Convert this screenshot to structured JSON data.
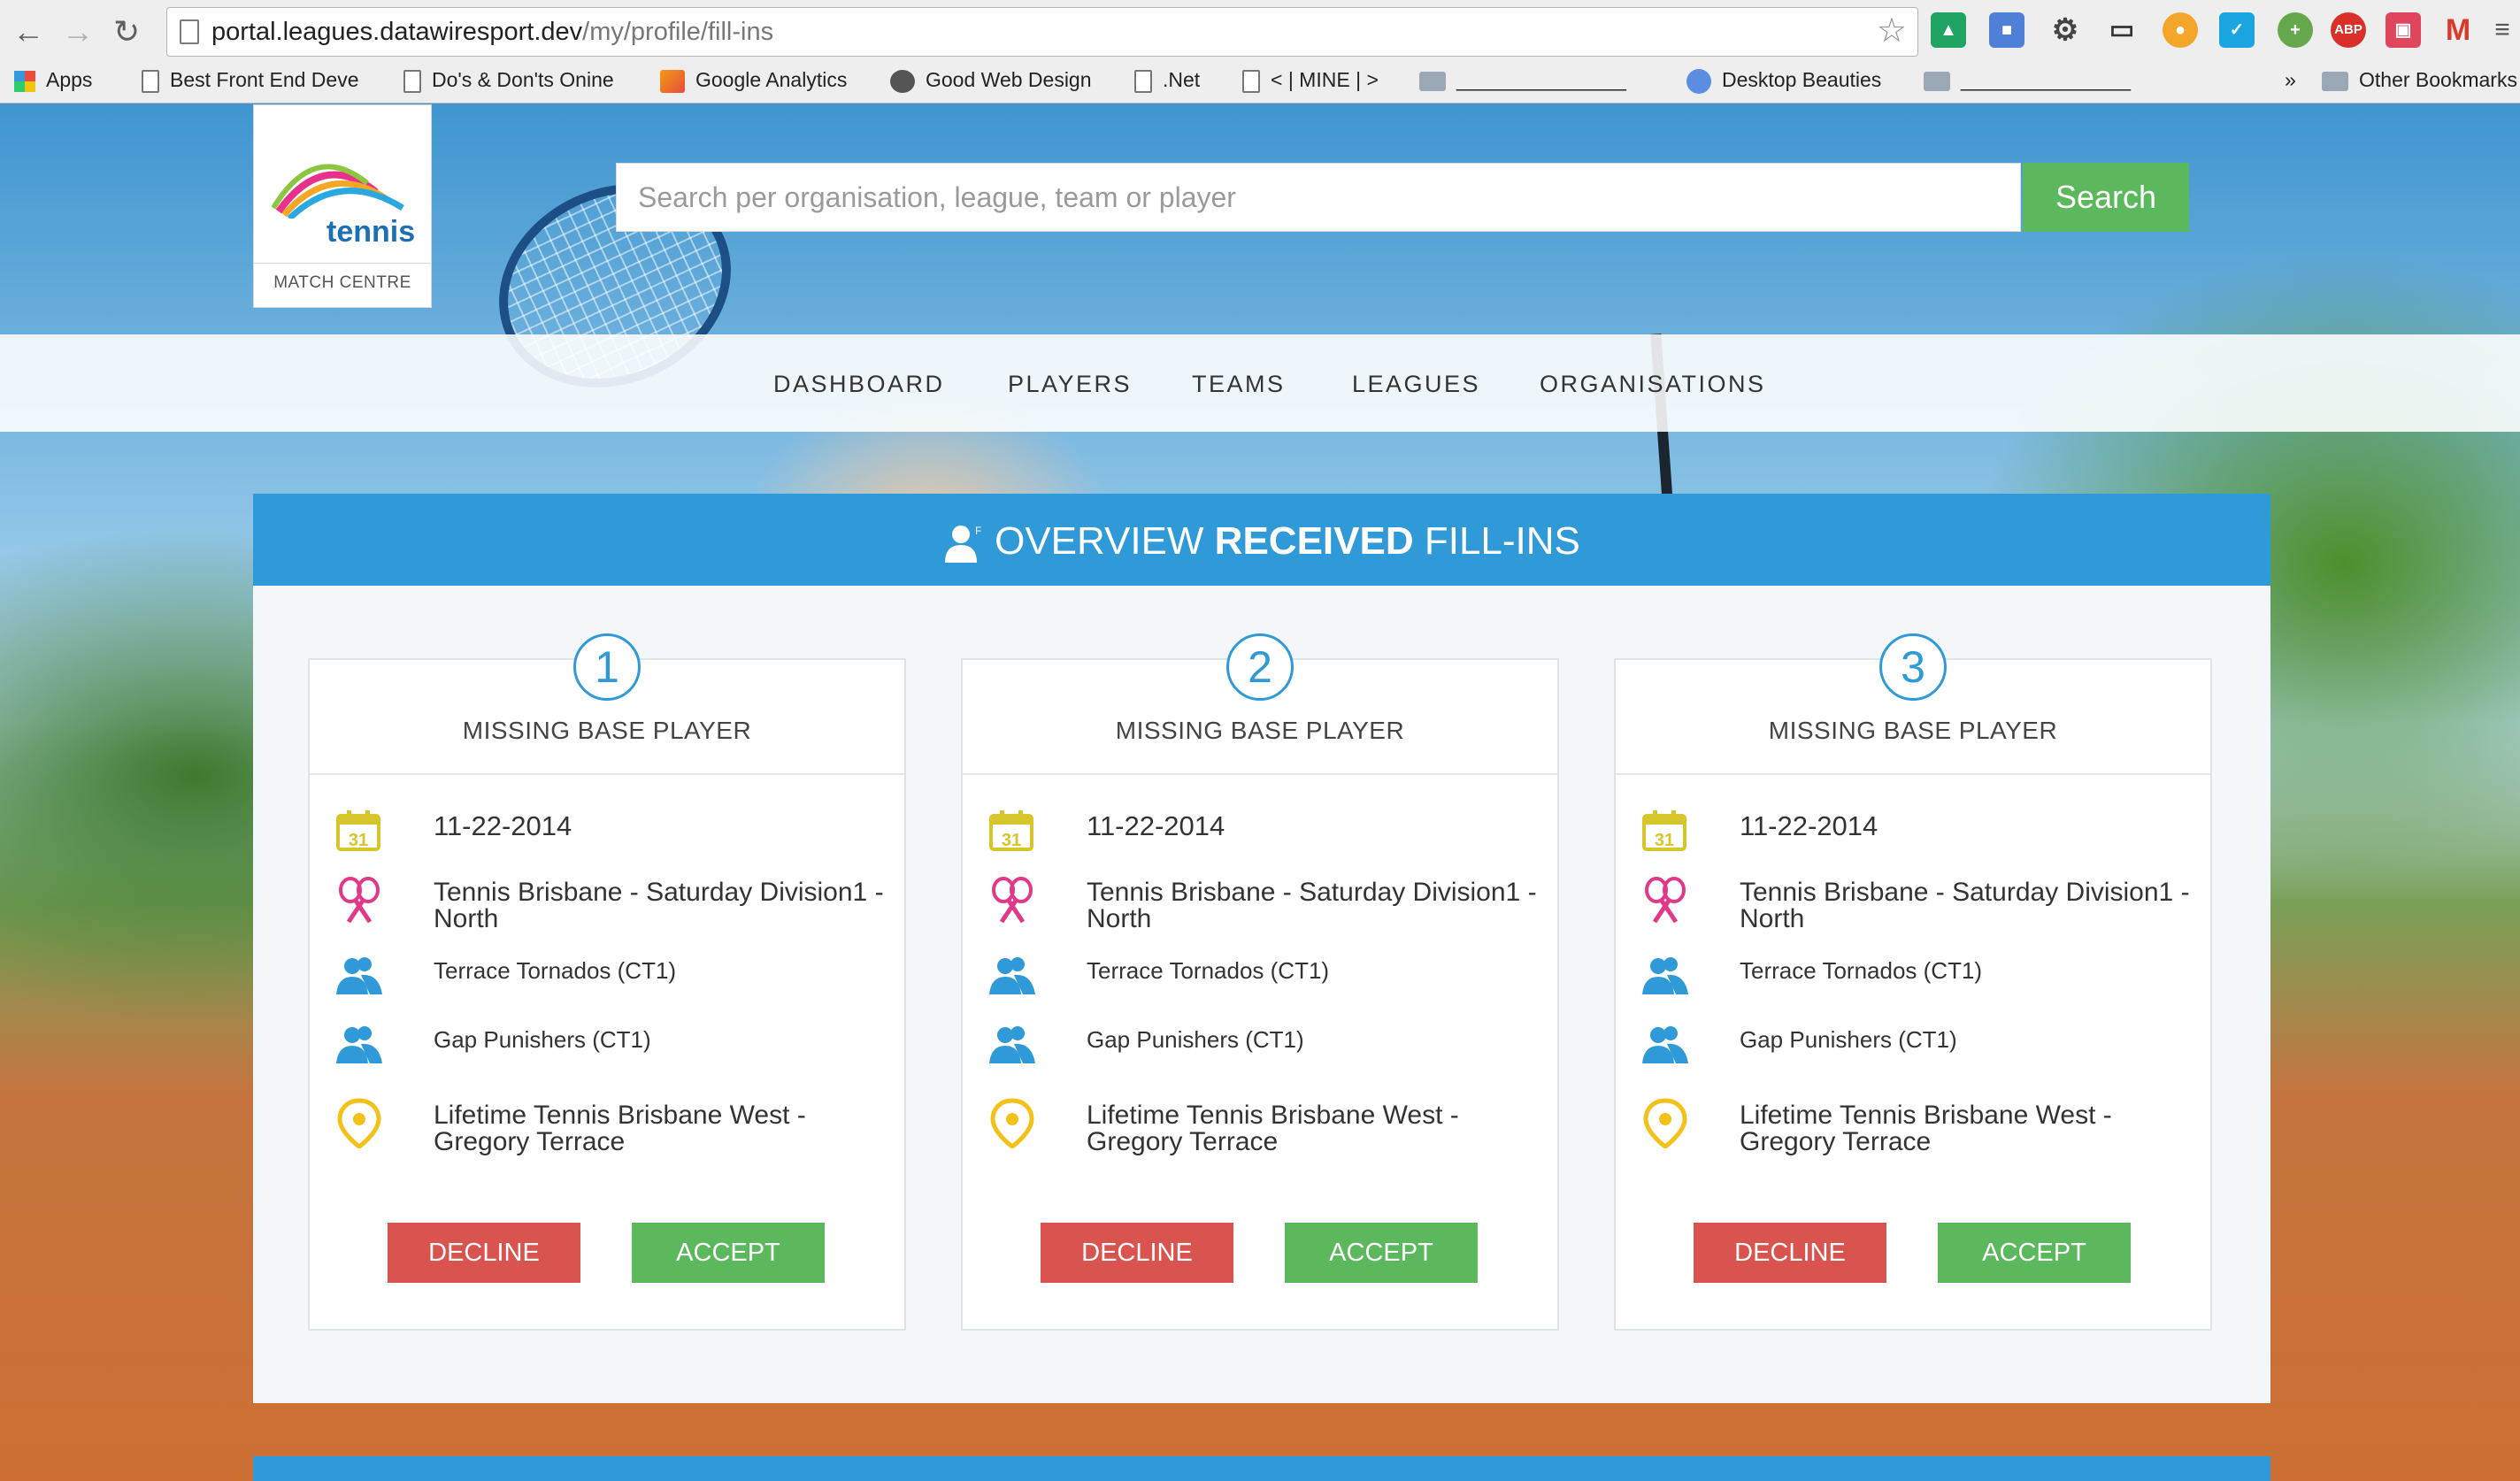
{
  "browser": {
    "url_host": "portal.leagues.datawiresport.dev",
    "url_path": "/my/profile/fill-ins",
    "bookmarks": [
      {
        "label": "Apps",
        "icon": "apps-icon"
      },
      {
        "label": "Best Front End Deve",
        "icon": "page-icon"
      },
      {
        "label": "Do's & Don'ts Onine",
        "icon": "page-icon"
      },
      {
        "label": "Google Analytics",
        "icon": "analytics-icon"
      },
      {
        "label": "Good Web Design",
        "icon": "gwd-icon"
      },
      {
        "label": ".Net",
        "icon": "page-icon"
      },
      {
        "label": "< | MINE | >",
        "icon": "page-icon"
      },
      {
        "label": "_______________",
        "icon": "folder-icon"
      },
      {
        "label": "Desktop Beauties",
        "icon": "globe-icon"
      },
      {
        "label": "_______________",
        "icon": "folder-icon"
      },
      {
        "label": "»",
        "icon": ""
      },
      {
        "label": "Other Bookmarks",
        "icon": "folder-icon"
      }
    ]
  },
  "site": {
    "logo_word": "tennis",
    "logo_sub": "MATCH CENTRE",
    "search": {
      "placeholder": "Search per organisation, league, team or player",
      "button": "Search"
    },
    "nav": [
      "DASHBOARD",
      "PLAYERS",
      "TEAMS",
      "LEAGUES",
      "ORGANISATIONS"
    ]
  },
  "panel": {
    "title_pre": "OVERVIEW ",
    "title_bold": "RECEIVED",
    "title_post": " FILL-INS",
    "colors": {
      "header": "#2f9ad7",
      "decline": "#d9534f",
      "accept": "#5cb85c"
    }
  },
  "cards": [
    {
      "number": "1",
      "title": "MISSING BASE PLAYER",
      "date": "11-22-2014",
      "league": "Tennis Brisbane - Saturday Division1 - North",
      "team1": "Terrace Tornados (CT1)",
      "team2": "Gap Punishers (CT1)",
      "venue": "Lifetime Tennis Brisbane West - Gregory Terrace",
      "decline": "DECLINE",
      "accept": "ACCEPT"
    },
    {
      "number": "2",
      "title": "MISSING BASE PLAYER",
      "date": "11-22-2014",
      "league": "Tennis Brisbane - Saturday Division1 - North",
      "team1": "Terrace Tornados (CT1)",
      "team2": "Gap Punishers (CT1)",
      "venue": "Lifetime Tennis Brisbane West - Gregory Terrace",
      "decline": "DECLINE",
      "accept": "ACCEPT"
    },
    {
      "number": "3",
      "title": "MISSING BASE PLAYER",
      "date": "11-22-2014",
      "league": "Tennis Brisbane - Saturday Division1 - North",
      "team1": "Terrace Tornados (CT1)",
      "team2": "Gap Punishers (CT1)",
      "venue": "Lifetime Tennis Brisbane West - Gregory Terrace",
      "decline": "DECLINE",
      "accept": "ACCEPT"
    }
  ]
}
